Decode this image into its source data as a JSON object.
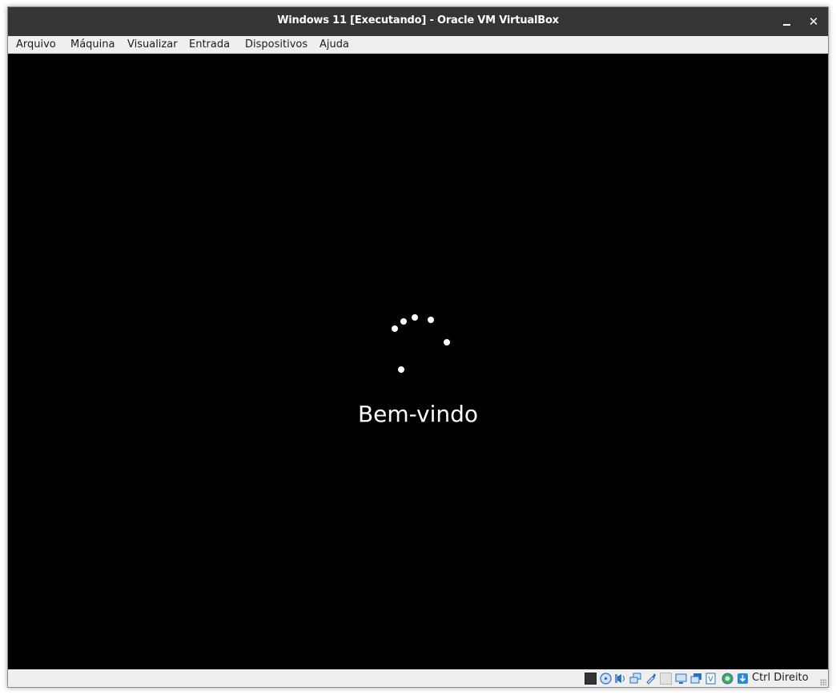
{
  "window": {
    "title": "Windows 11 [Executando] - Oracle VM VirtualBox",
    "controls": {
      "minimize_icon": "minimize-icon",
      "close_label": "✕"
    }
  },
  "menubar": {
    "items": [
      "Arquivo",
      "Máquina",
      "Visualizar",
      "Entrada",
      "Dispositivos",
      "Ajuda"
    ]
  },
  "guest": {
    "welcome_text": "Bem-vindo",
    "background": "#000000",
    "spinner_color": "#ffffff"
  },
  "statusbar": {
    "icons": [
      "mouse-capture-icon",
      "optical-drive-icon",
      "audio-icon",
      "network-icon",
      "usb-icon",
      "shared-folders-icon",
      "display-icon",
      "video-capture-icon",
      "cpu-virtualization-icon",
      "guest-additions-icon",
      "download-arrow-icon"
    ],
    "host_key": "Ctrl Direito"
  }
}
